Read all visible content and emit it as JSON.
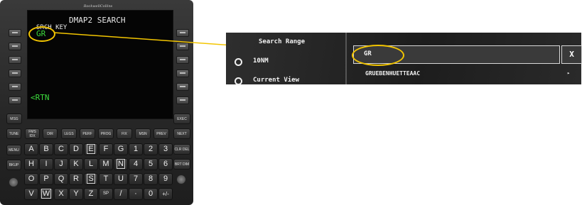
{
  "fms": {
    "brand": "RockwellCollins",
    "screen": {
      "title": "DMAP2 SEARCH",
      "scratch_label": "SRCH KEY",
      "scratch_value": "GR",
      "return_label": "<RTN"
    },
    "function_keys_row1": [
      "MSG",
      "EXEC"
    ],
    "function_keys_row2": [
      "TUNE",
      "FMS IDX",
      "DIR",
      "LEGS",
      "PERF",
      "PROG",
      "FIX",
      "MSN",
      "PREV",
      "NEXT"
    ],
    "side_keys_left": [
      "MENU",
      "BKUP"
    ],
    "side_keys_right": [
      "CLR DEL",
      "BRT DIM"
    ],
    "alpha_rows": [
      [
        "A",
        "B",
        "C",
        "D",
        "E",
        "F",
        "G",
        "1",
        "2",
        "3"
      ],
      [
        "H",
        "I",
        "J",
        "K",
        "L",
        "M",
        "N",
        "4",
        "5",
        "6"
      ],
      [
        "O",
        "P",
        "Q",
        "R",
        "S",
        "T",
        "U",
        "7",
        "8",
        "9"
      ],
      [
        "V",
        "W",
        "X",
        "Y",
        "Z",
        "SP",
        "/",
        "·",
        "0",
        "+/-"
      ]
    ]
  },
  "panel": {
    "search_range_label": "Search Range",
    "options": [
      "10NM",
      "Current View"
    ],
    "search_value": "GR",
    "clear_button": "X",
    "result": "GRUEBENHUETTEAAC",
    "result_arrow": "▸"
  },
  "colors": {
    "callout": "#f3c500",
    "fms_green": "#3ddc3d",
    "panel_bg": "#262626"
  }
}
